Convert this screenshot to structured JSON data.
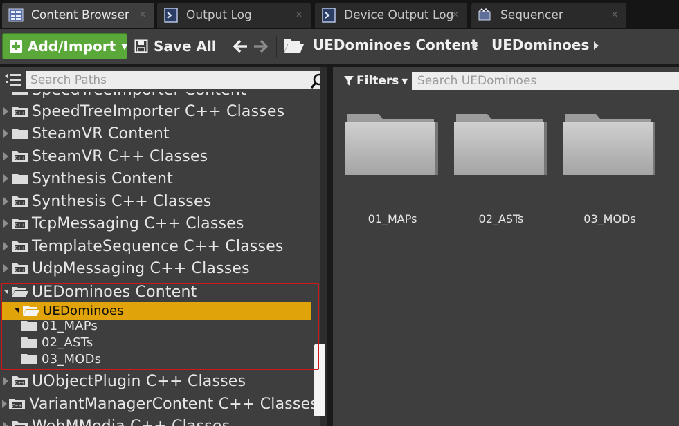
{
  "tabs": [
    {
      "label": "Content Browser",
      "icon": "content-browser-icon",
      "active": true
    },
    {
      "label": "Output Log",
      "icon": "output-log-icon",
      "active": false
    },
    {
      "label": "Device Output Log",
      "icon": "device-output-log-icon",
      "active": false
    },
    {
      "label": "Sequencer",
      "icon": "sequencer-icon",
      "active": false
    }
  ],
  "toolbar": {
    "add_import_label": "Add/Import",
    "save_all_label": "Save All",
    "breadcrumb": [
      "UEDominoes Content",
      "UEDominoes"
    ]
  },
  "path_panel": {
    "search_placeholder": "Search Paths",
    "tree": [
      {
        "label": "SpeedTreeImporter Content",
        "icon": "folder-icon",
        "type": "content"
      },
      {
        "label": "SpeedTreeImporter C++ Classes",
        "icon": "cpp-folder-icon",
        "type": "cpp"
      },
      {
        "label": "SteamVR Content",
        "icon": "folder-icon",
        "type": "content"
      },
      {
        "label": "SteamVR C++ Classes",
        "icon": "cpp-folder-icon",
        "type": "cpp"
      },
      {
        "label": "Synthesis Content",
        "icon": "folder-icon",
        "type": "content"
      },
      {
        "label": "Synthesis C++ Classes",
        "icon": "cpp-folder-icon",
        "type": "cpp"
      },
      {
        "label": "TcpMessaging C++ Classes",
        "icon": "cpp-folder-icon",
        "type": "cpp"
      },
      {
        "label": "TemplateSequence C++ Classes",
        "icon": "cpp-folder-icon",
        "type": "cpp"
      },
      {
        "label": "UdpMessaging C++ Classes",
        "icon": "cpp-folder-icon",
        "type": "cpp"
      },
      {
        "label": "UEDominoes Content",
        "icon": "open-folder-icon",
        "type": "expanded"
      },
      {
        "label": "UEDominoes",
        "icon": "open-folder-icon",
        "type": "selected"
      },
      {
        "label": "01_MAPs",
        "icon": "folder-icon",
        "type": "child"
      },
      {
        "label": "02_ASTs",
        "icon": "folder-icon",
        "type": "child"
      },
      {
        "label": "03_MODs",
        "icon": "folder-icon",
        "type": "child"
      },
      {
        "label": "UObjectPlugin C++ Classes",
        "icon": "cpp-folder-icon",
        "type": "cpp"
      },
      {
        "label": "VariantManagerContent C++ Classes",
        "icon": "cpp-folder-icon",
        "type": "cpp"
      },
      {
        "label": "WebMMedia C++ Classes",
        "icon": "cpp-folder-icon",
        "type": "cpp"
      }
    ]
  },
  "asset_panel": {
    "filters_label": "Filters",
    "search_placeholder": "Search UEDominoes",
    "folders": [
      {
        "label": "01_MAPs",
        "icon": "folder-icon"
      },
      {
        "label": "02_ASTs",
        "icon": "folder-icon"
      },
      {
        "label": "03_MODs",
        "icon": "folder-icon"
      }
    ]
  },
  "colors": {
    "accent_selected": "#e0a30a",
    "add_button": "#5aa839",
    "highlight_box": "#d01818",
    "panel_bg": "#3e3e3e"
  }
}
